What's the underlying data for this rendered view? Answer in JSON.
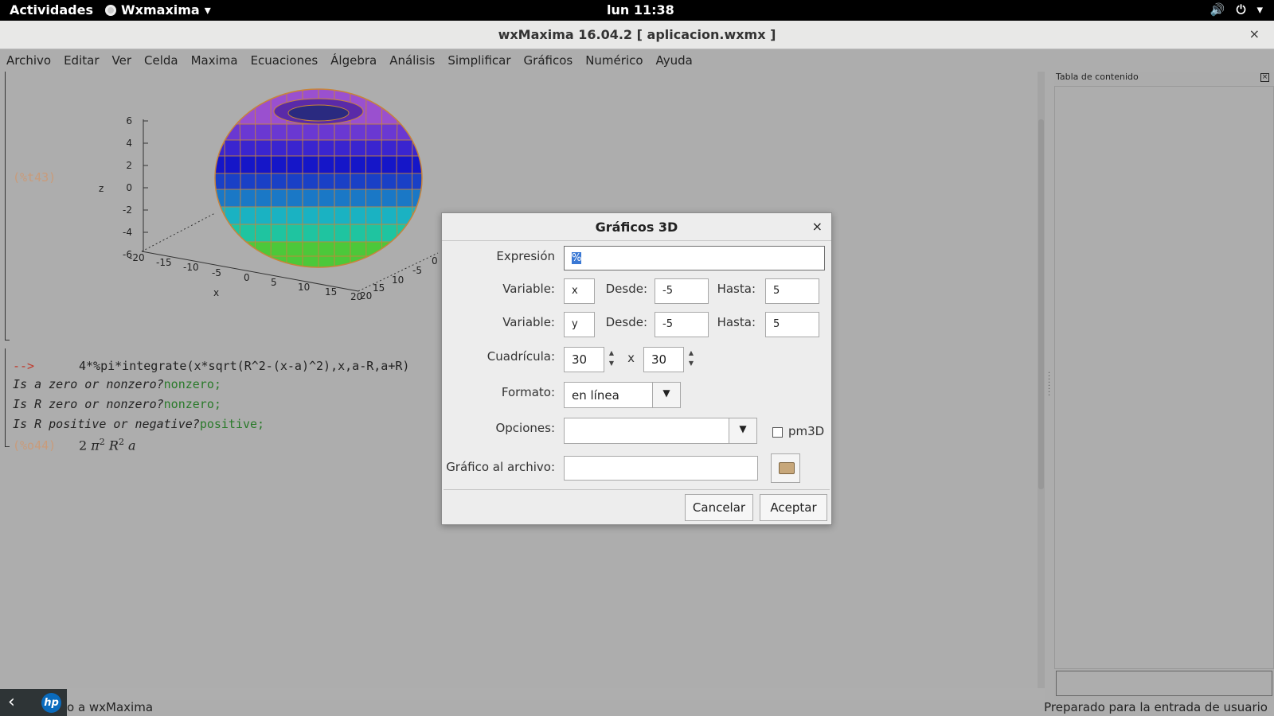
{
  "topbar": {
    "activities": "Actividades",
    "app_name": "Wxmaxima",
    "clock": "lun 11:38"
  },
  "window": {
    "title": "wxMaxima 16.04.2  [ aplicacion.wxmx ]",
    "close": "×"
  },
  "menu": [
    "Archivo",
    "Editar",
    "Ver",
    "Celda",
    "Maxima",
    "Ecuaciones",
    "Álgebra",
    "Análisis",
    "Simplificar",
    "Gráficos",
    "Numérico",
    "Ayuda"
  ],
  "worksheet": {
    "plot_label": "(%t43)",
    "plot": {
      "z_label": "z",
      "x_label": "x",
      "z_ticks": [
        "6",
        "4",
        "2",
        "0",
        "-2",
        "-4",
        "-6"
      ],
      "x_ticks": [
        "-20",
        "-15",
        "-10",
        "-5",
        "0",
        "5",
        "10",
        "15",
        "20"
      ],
      "y_ticks": [
        "20",
        "15",
        "10",
        "-5",
        "0"
      ]
    },
    "input_prompt": "-->",
    "input_code": "4*%pi*integrate(x*sqrt(R^2-(x-a)^2),x,a-R,a+R)",
    "questions": [
      {
        "q": "Is a zero or nonzero?",
        "a": "nonzero;"
      },
      {
        "q": "Is R zero or nonzero?",
        "a": "nonzero;"
      },
      {
        "q": "Is R positive or negative?",
        "a": "positive;"
      }
    ],
    "output_label": "(%o44)",
    "output": {
      "coef": "2",
      "pi": "π",
      "pi_exp": "2",
      "r": "R",
      "r_exp": "2",
      "a": "a"
    }
  },
  "toc": {
    "title": "Tabla de contenido",
    "close": "×"
  },
  "status": {
    "left": "o a wxMaxima",
    "right": "Preparado para la entrada de usuario"
  },
  "dialog": {
    "title": "Gráficos 3D",
    "close": "×",
    "expresion_label": "Expresión",
    "expresion_value": "%",
    "row1": {
      "var_label": "Variable:",
      "var": "x",
      "desde_label": "Desde:",
      "desde": "-5",
      "hasta_label": "Hasta:",
      "hasta": "5"
    },
    "row2": {
      "var_label": "Variable:",
      "var": "y",
      "desde_label": "Desde:",
      "desde": "-5",
      "hasta_label": "Hasta:",
      "hasta": "5"
    },
    "grid_label": "Cuadrícula:",
    "grid_x": "30",
    "grid_sep": "x",
    "grid_y": "30",
    "formato_label": "Formato:",
    "formato_value": "en línea",
    "opciones_label": "Opciones:",
    "opciones_value": "",
    "pm3d_label": "pm3D",
    "archivo_label": "Gráfico al archivo:",
    "archivo_value": "",
    "cancel": "Cancelar",
    "ok": "Aceptar"
  },
  "colors": {
    "torus_top": "#9b4fd0",
    "torus_mid": "#1a1ad0",
    "torus_low": "#1ab0c8",
    "torus_bottom": "#4ac83a",
    "grid_lines": "#c8843a"
  }
}
